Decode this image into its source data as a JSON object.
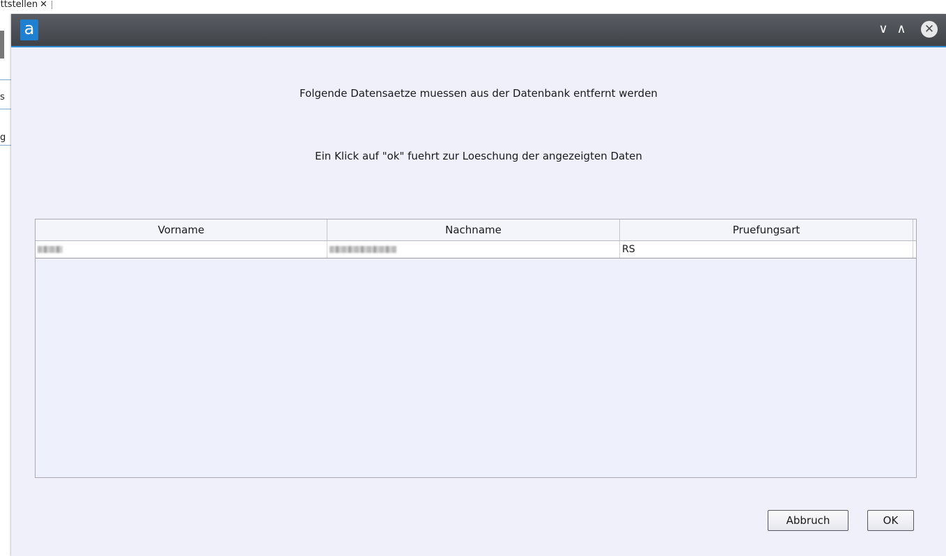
{
  "background": {
    "tab_label": "ittstellen",
    "tab_close": "✕",
    "side_letters": [
      "s",
      "g"
    ]
  },
  "dialog": {
    "logo": "a",
    "window_controls": {
      "minimize": "∨",
      "maximize": "∧",
      "close": "✕"
    },
    "message_line1": "Folgende Datensaetze muessen aus der Datenbank entfernt werden",
    "message_line2": "Ein Klick auf \"ok\" fuehrt zur Loeschung der angezeigten Daten",
    "table": {
      "columns": [
        "Vorname",
        "Nachname",
        "Pruefungsart"
      ],
      "rows": [
        {
          "pruefungsart": "RS"
        }
      ]
    },
    "buttons": {
      "cancel": "Abbruch",
      "ok": "OK"
    }
  },
  "colors": {
    "titlebar": "#4a4e54",
    "accent": "#2f8fd8",
    "dialog_bg": "#f0f0fa"
  }
}
